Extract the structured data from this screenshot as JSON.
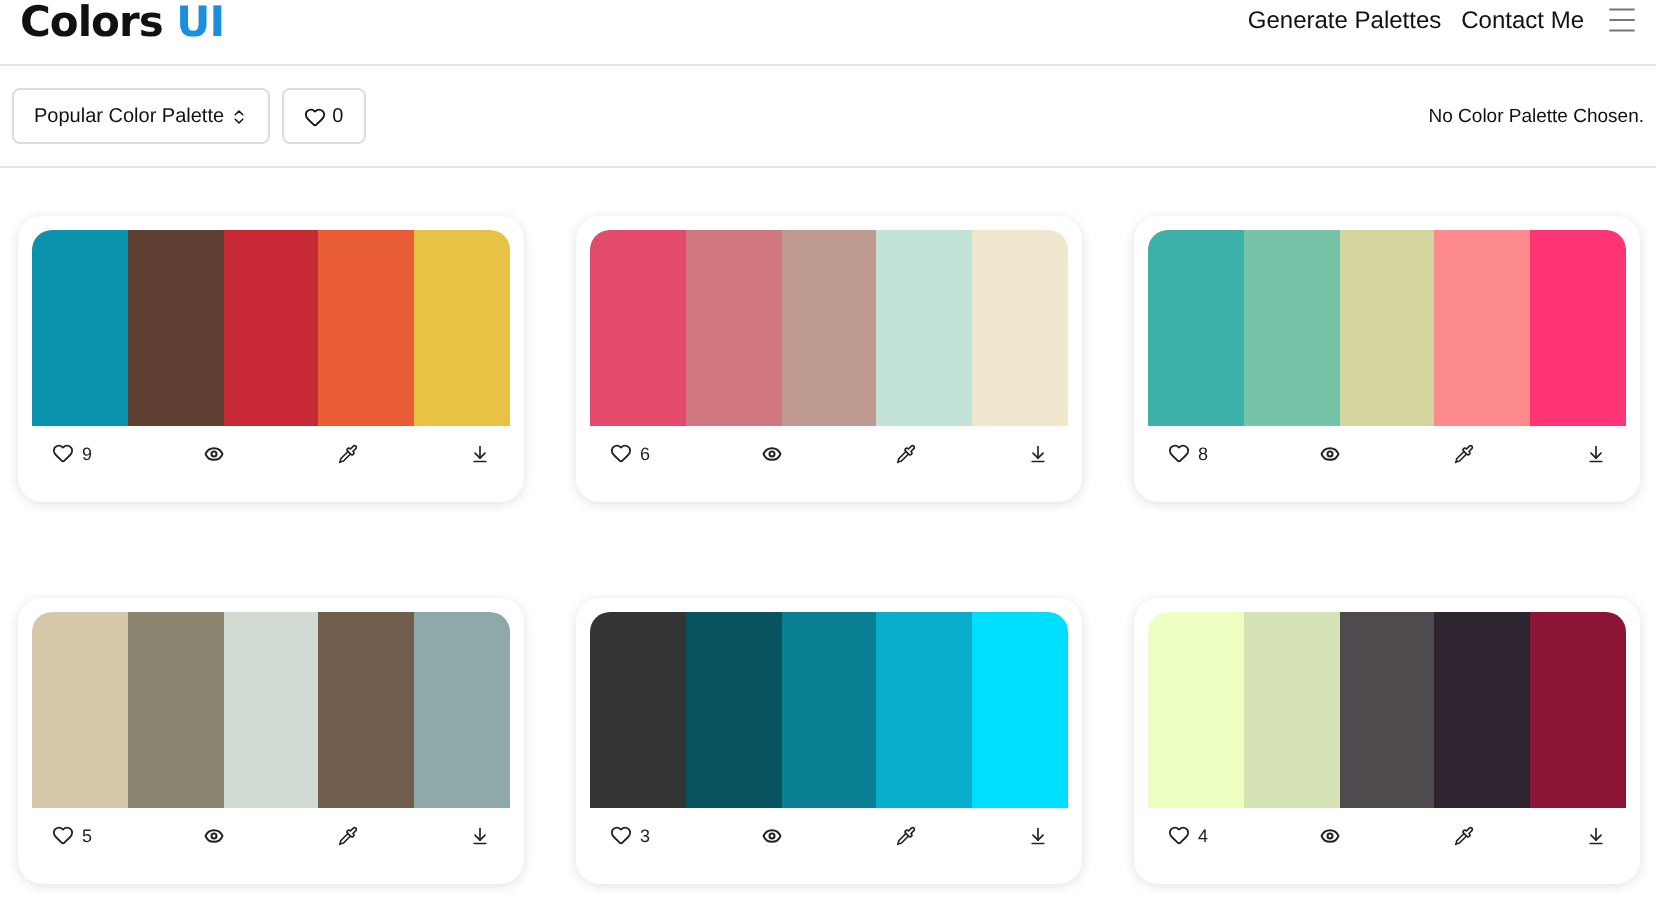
{
  "brand": {
    "name": "Colors",
    "accent": "UI"
  },
  "nav": [
    "Generate Palettes",
    "Contact Me"
  ],
  "toolbar": {
    "sort": "Popular Color Palette",
    "likes": "0",
    "status": "No Color Palette Chosen."
  },
  "palettes": [
    {
      "likes": "9",
      "swatches": [
        {
          "color": "#0b93ad"
        },
        {
          "color": "#5e3f31"
        },
        {
          "color": "#c72a35"
        },
        {
          "color": "#e85d36"
        },
        {
          "color": "#e8c244"
        }
      ]
    },
    {
      "likes": "6",
      "swatches": [
        {
          "color": "#e44a6a"
        },
        {
          "color": "#d27880"
        },
        {
          "color": "#be9a91"
        },
        {
          "color": "#c3e3d6"
        },
        {
          "color": "#f1e6ce"
        }
      ]
    },
    {
      "likes": "8",
      "swatches": [
        {
          "color": "#3bb1a7"
        },
        {
          "color": "#76c3a8"
        },
        {
          "color": "#d5d5a0"
        },
        {
          "color": "#fd8a8c"
        },
        {
          "color": "#fe3474"
        }
      ]
    },
    {
      "likes": "5",
      "swatches": [
        {
          "color": "#d4c8a8"
        },
        {
          "color": "#8c8670"
        },
        {
          "color": "#d1dad3"
        },
        {
          "color": "#725e4c"
        },
        {
          "color": "#8fa8aa"
        }
      ]
    },
    {
      "likes": "3",
      "swatches": [
        {
          "color": "#333535"
        },
        {
          "color": "#07535f"
        },
        {
          "color": "#0a7f93"
        },
        {
          "color": "#08adcb"
        },
        {
          "color": "#00deff"
        }
      ]
    },
    {
      "likes": "4",
      "swatches": [
        {
          "color": "#eeffc2"
        },
        {
          "color": "#d6e4b5"
        },
        {
          "color": "#4f4a4d"
        },
        {
          "color": "#2d2430"
        },
        {
          "color": "#8c1535"
        }
      ]
    }
  ]
}
